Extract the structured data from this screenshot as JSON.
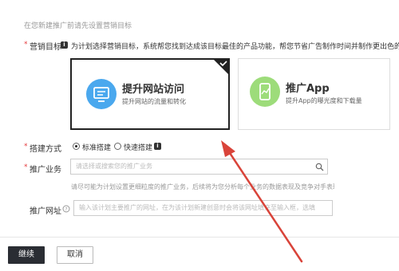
{
  "section_hint": "在您新建推广前请先设置营销目标",
  "marketing_goal": {
    "label": "营销目标",
    "desc": "为计划选择营销目标，系统帮您找到达成该目标最佳的产品功能，帮您节省广告制作时间并制作更出色的",
    "cards": [
      {
        "title": "提升网站访问",
        "sub": "提升网站的流量和转化",
        "selected": true
      },
      {
        "title": "推广App",
        "sub": "提升App的曝光度和下载量",
        "selected": false
      }
    ]
  },
  "build_mode": {
    "label": "搭建方式",
    "options": [
      {
        "label": "标准搭建",
        "checked": true
      },
      {
        "label": "快速搭建",
        "checked": false
      }
    ]
  },
  "business": {
    "label": "推广业务",
    "placeholder": "请选择或搜索您的推广业务",
    "help": "请尽可能为计划设置更细粒度的推广业务，后续将为您分析每个业务的数据表现及竞争对手表现"
  },
  "url": {
    "label": "推广网址",
    "placeholder": "输入该计划主要推广的网址，在为该计划新建创意时会将该网址填充至输入框，选填"
  },
  "buttons": {
    "continue": "继续",
    "cancel": "取消"
  },
  "colors": {
    "primary_dark": "#222222",
    "app_green": "#9ddc7a",
    "web_blue": "#4aa8ee",
    "required": "#e4393c",
    "arrow": "#d9443a"
  },
  "icons": {
    "info": "info-icon",
    "help": "question-circle-icon",
    "search": "search-icon",
    "check": "check-corner-icon"
  }
}
